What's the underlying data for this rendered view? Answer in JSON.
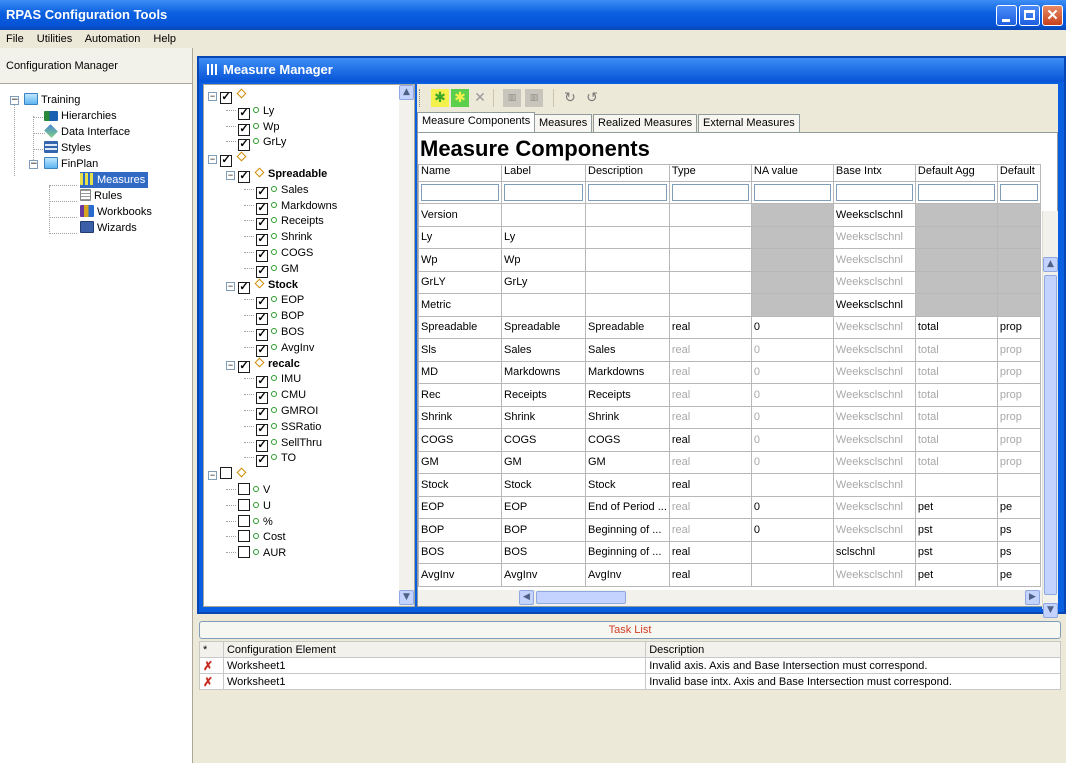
{
  "app": {
    "title": "RPAS Configuration Tools"
  },
  "menu": [
    "File",
    "Utilities",
    "Automation",
    "Help"
  ],
  "sidebar": {
    "header": "Configuration Manager",
    "items": [
      {
        "label": "Training",
        "icon": "folder-icon"
      },
      {
        "label": "Hierarchies",
        "icon": "hierarchy-icon"
      },
      {
        "label": "Data Interface",
        "icon": "data-interface-icon"
      },
      {
        "label": "Styles",
        "icon": "styles-icon"
      },
      {
        "label": "FinPlan",
        "icon": "folder-icon"
      },
      {
        "label": "Measures",
        "icon": "measures-icon",
        "selected": true
      },
      {
        "label": "Rules",
        "icon": "rules-icon"
      },
      {
        "label": "Workbooks",
        "icon": "workbooks-icon"
      },
      {
        "label": "Wizards",
        "icon": "wizards-icon"
      }
    ]
  },
  "measure_manager": {
    "title": "Measure Manager",
    "tree": [
      {
        "label": "",
        "checked": true,
        "level": 0
      },
      {
        "label": "Ly",
        "checked": true,
        "level": 1
      },
      {
        "label": "Wp",
        "checked": true,
        "level": 1
      },
      {
        "label": "GrLy",
        "checked": true,
        "level": 1
      },
      {
        "label": "",
        "checked": true,
        "level": 0
      },
      {
        "label": "Spreadable",
        "checked": true,
        "level": 1,
        "group": true
      },
      {
        "label": "Sales",
        "checked": true,
        "level": 2
      },
      {
        "label": "Markdowns",
        "checked": true,
        "level": 2
      },
      {
        "label": "Receipts",
        "checked": true,
        "level": 2
      },
      {
        "label": "Shrink",
        "checked": true,
        "level": 2
      },
      {
        "label": "COGS",
        "checked": true,
        "level": 2
      },
      {
        "label": "GM",
        "checked": true,
        "level": 2
      },
      {
        "label": "Stock",
        "checked": true,
        "level": 1,
        "group": true
      },
      {
        "label": "EOP",
        "checked": true,
        "level": 2
      },
      {
        "label": "BOP",
        "checked": true,
        "level": 2
      },
      {
        "label": "BOS",
        "checked": true,
        "level": 2
      },
      {
        "label": "AvgInv",
        "checked": true,
        "level": 2
      },
      {
        "label": "recalc",
        "checked": true,
        "level": 1,
        "group": true
      },
      {
        "label": "IMU",
        "checked": true,
        "level": 2
      },
      {
        "label": "CMU",
        "checked": true,
        "level": 2
      },
      {
        "label": "GMROI",
        "checked": true,
        "level": 2
      },
      {
        "label": "SSRatio",
        "checked": true,
        "level": 2
      },
      {
        "label": "SellThru",
        "checked": true,
        "level": 2
      },
      {
        "label": "TO",
        "checked": true,
        "level": 2
      },
      {
        "label": "",
        "checked": false,
        "level": 0
      },
      {
        "label": "V",
        "checked": false,
        "level": 1
      },
      {
        "label": "U",
        "checked": false,
        "level": 1
      },
      {
        "label": "%",
        "checked": false,
        "level": 1
      },
      {
        "label": "Cost",
        "checked": false,
        "level": 1
      },
      {
        "label": "AUR",
        "checked": false,
        "level": 1
      }
    ],
    "tabs": [
      "Measure Components",
      "Measures",
      "Realized Measures",
      "External Measures"
    ],
    "active_tab": "Measure Components",
    "heading": "Measure Components",
    "columns": [
      "Name",
      "Label",
      "Description",
      "Type",
      "NA value",
      "Base Intx",
      "Default Agg",
      "Default"
    ],
    "rows": [
      [
        "Version",
        "",
        "",
        "",
        "",
        "Weeksclschnl",
        "",
        ""
      ],
      [
        "Ly",
        "Ly",
        "",
        "",
        "",
        "Weeksclschnl",
        "",
        ""
      ],
      [
        "Wp",
        "Wp",
        "",
        "",
        "",
        "Weeksclschnl",
        "",
        ""
      ],
      [
        "GrLY",
        "GrLy",
        "",
        "",
        "",
        "Weeksclschnl",
        "",
        ""
      ],
      [
        "Metric",
        "",
        "",
        "",
        "",
        "Weeksclschnl",
        "",
        ""
      ],
      [
        "Spreadable",
        "Spreadable",
        "Spreadable",
        "real",
        "0",
        "Weeksclschnl",
        "total",
        "prop"
      ],
      [
        "Sls",
        "Sales",
        "Sales",
        "real",
        "0",
        "Weeksclschnl",
        "total",
        "prop"
      ],
      [
        "MD",
        "Markdowns",
        "Markdowns",
        "real",
        "0",
        "Weeksclschnl",
        "total",
        "prop"
      ],
      [
        "Rec",
        "Receipts",
        "Receipts",
        "real",
        "0",
        "Weeksclschnl",
        "total",
        "prop"
      ],
      [
        "Shrink",
        "Shrink",
        "Shrink",
        "real",
        "0",
        "Weeksclschnl",
        "total",
        "prop"
      ],
      [
        "COGS",
        "COGS",
        "COGS",
        "real",
        "0",
        "Weeksclschnl",
        "total",
        "prop"
      ],
      [
        "GM",
        "GM",
        "GM",
        "real",
        "0",
        "Weeksclschnl",
        "total",
        "prop"
      ],
      [
        "Stock",
        "Stock",
        "Stock",
        "real",
        "",
        "Weeksclschnl",
        "",
        ""
      ],
      [
        "EOP",
        "EOP",
        "End of Period ...",
        "real",
        "0",
        "Weeksclschnl",
        "pet",
        "pe"
      ],
      [
        "BOP",
        "BOP",
        "Beginning of ...",
        "real",
        "0",
        "Weeksclschnl",
        "pst",
        "ps"
      ],
      [
        "BOS",
        "BOS",
        "Beginning of ...",
        "real",
        "",
        "sclschnl",
        "pst",
        "ps"
      ],
      [
        "AvgInv",
        "AvgInv",
        "AvgInv",
        "real",
        "",
        "Weeksclschnl",
        "pet",
        "pe"
      ]
    ]
  },
  "task_list": {
    "title": "Task List",
    "columns": [
      "*",
      "Configuration Element",
      "Description"
    ],
    "rows": [
      [
        "Worksheet1",
        "Invalid axis. Axis and Base Intersection must correspond."
      ],
      [
        "Worksheet1",
        "Invalid base intx. Axis and Base Intersection must correspond."
      ]
    ]
  }
}
